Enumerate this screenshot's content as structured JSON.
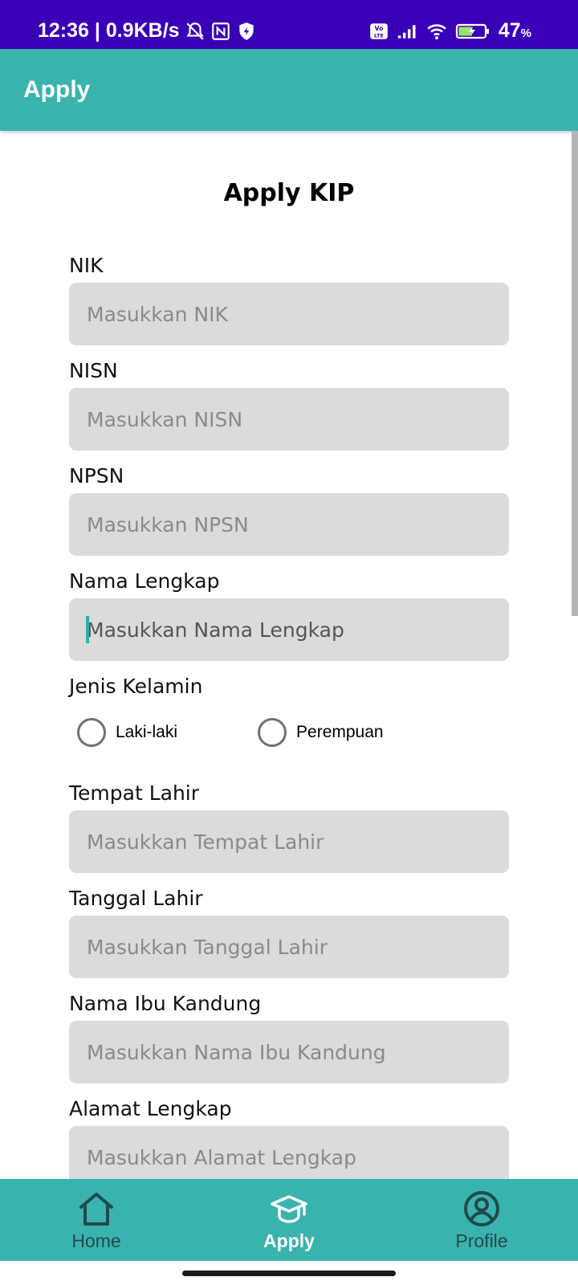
{
  "status_bar": {
    "time_speed": "12:36 | 0.9KB/s",
    "battery": "47",
    "battery_unit": "%"
  },
  "app_bar": {
    "title": "Apply"
  },
  "form": {
    "title": "Apply KIP",
    "fields": {
      "nik": {
        "label": "NIK",
        "placeholder": "Masukkan NIK"
      },
      "nisn": {
        "label": "NISN",
        "placeholder": "Masukkan NISN"
      },
      "npsn": {
        "label": "NPSN",
        "placeholder": "Masukkan NPSN"
      },
      "nama": {
        "label": "Nama Lengkap",
        "placeholder": "Masukkan Nama Lengkap"
      },
      "tempat": {
        "label": "Tempat Lahir",
        "placeholder": "Masukkan Tempat Lahir"
      },
      "tanggal": {
        "label": "Tanggal Lahir",
        "placeholder": "Masukkan Tanggal Lahir"
      },
      "ibu": {
        "label": "Nama Ibu Kandung",
        "placeholder": "Masukkan Nama Ibu Kandung"
      },
      "alamat": {
        "label": "Alamat Lengkap",
        "placeholder": "Masukkan Alamat Lengkap"
      }
    },
    "gender": {
      "label": "Jenis Kelamin",
      "options": [
        "Laki-laki",
        "Perempuan"
      ]
    }
  },
  "bottom_nav": {
    "items": [
      {
        "label": "Home",
        "icon": "home-icon"
      },
      {
        "label": "Apply",
        "icon": "graduation-cap-icon"
      },
      {
        "label": "Profile",
        "icon": "profile-icon"
      }
    ],
    "active": "Apply"
  },
  "colors": {
    "status_bar": "#3a00b8",
    "accent": "#3ab3ae",
    "field_bg": "#dcdbda",
    "cursor": "#28b0a6"
  }
}
